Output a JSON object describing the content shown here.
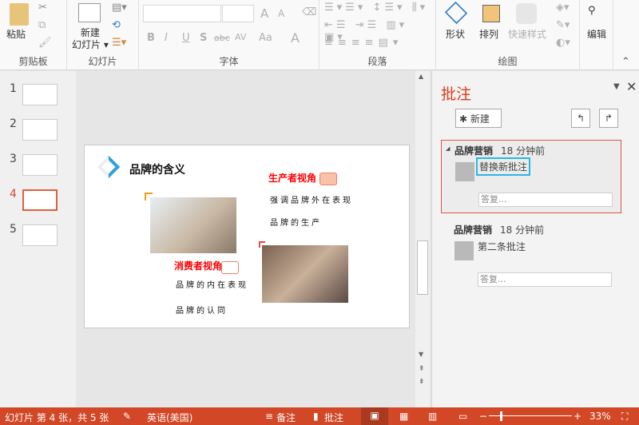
{
  "ribbon": {
    "clipboard": {
      "paste": "粘贴",
      "label": "剪贴板"
    },
    "slides": {
      "new_slide_1": "新建",
      "new_slide_2": "幻灯片",
      "label": "幻灯片"
    },
    "font": {
      "label": "字体",
      "bold": "B",
      "italic": "I",
      "underline": "U",
      "shadow": "S",
      "strike": "abc",
      "spacing": "AV",
      "case": "Aa",
      "grow": "A",
      "shrink": "A",
      "color": "A"
    },
    "paragraph": {
      "label": "段落"
    },
    "drawing": {
      "shape": "形状",
      "arrange": "排列",
      "quick_style": "快速样式",
      "label": "绘图"
    },
    "editing": {
      "label": "编辑"
    }
  },
  "thumbnails": [
    {
      "num": "1"
    },
    {
      "num": "2"
    },
    {
      "num": "3"
    },
    {
      "num": "4"
    },
    {
      "num": "5"
    }
  ],
  "slide": {
    "title": "品牌的含义",
    "producer_heading": "生产者视角",
    "producer_lines": [
      "强调品牌外在表现",
      "品牌的生产"
    ],
    "consumer_heading": "消费者视角",
    "consumer_lines": [
      "品牌的内在表现",
      "品牌的认同"
    ]
  },
  "comments": {
    "title": "批注",
    "new_label": "新建",
    "items": [
      {
        "author": "品牌营销",
        "time": "18 分钟前",
        "text": "替换新批注",
        "reply": "答复..."
      },
      {
        "author": "品牌营销",
        "time": "18 分钟前",
        "text": "第二条批注",
        "reply": "答复..."
      }
    ]
  },
  "status": {
    "slide_info": "幻灯片 第 4 张，共 5 张",
    "language": "英语(美国)",
    "notes": "备注",
    "comments": "批注",
    "zoom": "33%"
  },
  "colors": {
    "accent": "#d24726",
    "title_red": "#e03a16",
    "highlight": "#29b6e8"
  }
}
